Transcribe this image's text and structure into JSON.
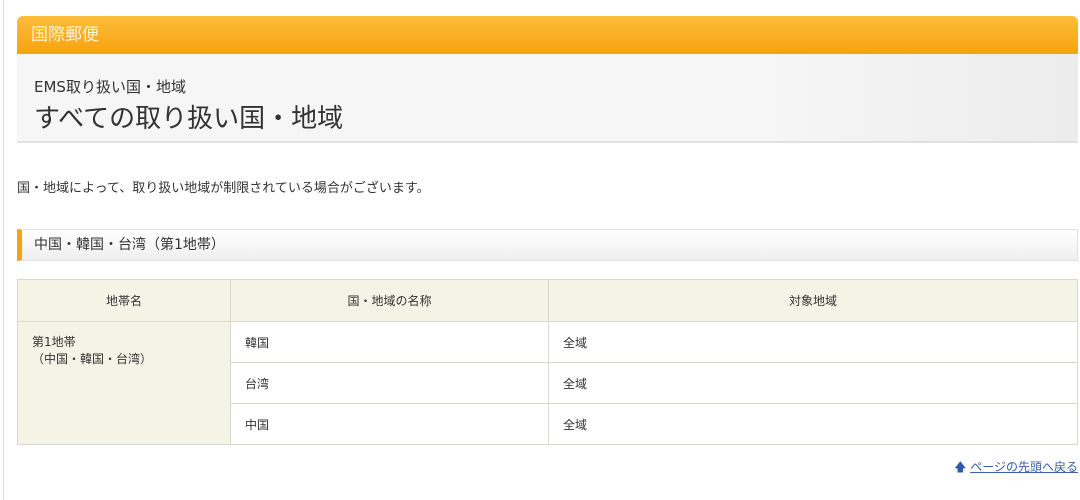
{
  "header": {
    "banner": "国際郵便",
    "subtitle": "EMS取り扱い国・地域",
    "title": "すべての取り扱い国・地域"
  },
  "intro": "国・地域によって、取り扱い地域が制限されている場合がございます。",
  "section": {
    "heading": "中国・韓国・台湾（第1地帯）"
  },
  "table": {
    "headers": [
      "地帯名",
      "国・地域の名称",
      "対象地域"
    ],
    "zone": {
      "line1": "第1地帯",
      "line2": "（中国・韓国・台湾）"
    },
    "rows": [
      {
        "country": "韓国",
        "area": "全域"
      },
      {
        "country": "台湾",
        "area": "全域"
      },
      {
        "country": "中国",
        "area": "全域"
      }
    ]
  },
  "back_to_top": {
    "icon": "arrow-up-icon",
    "label": "ページの先頭へ戻る"
  }
}
